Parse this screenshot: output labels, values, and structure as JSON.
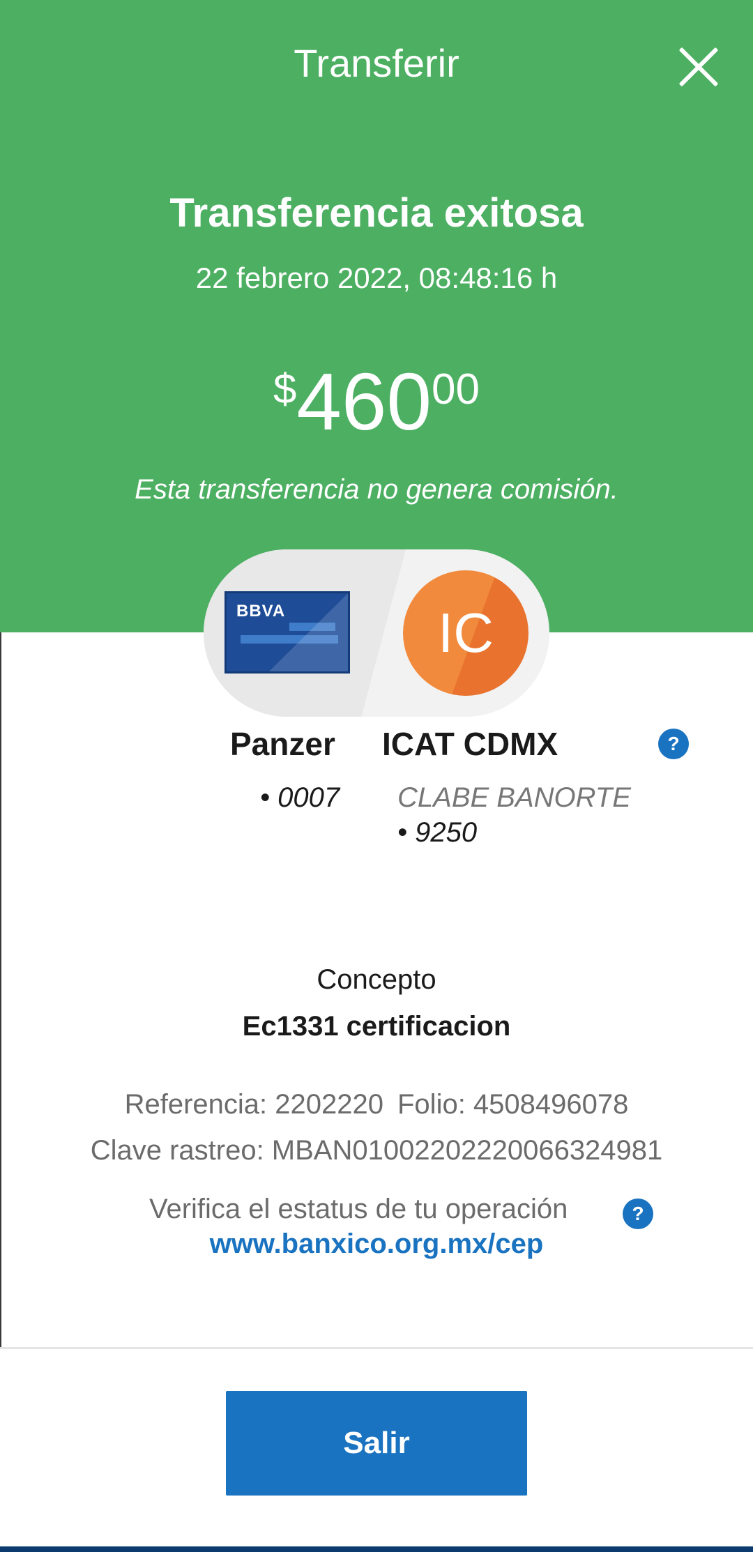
{
  "header": {
    "title": "Transferir",
    "bg_color": "#4caf62"
  },
  "summary": {
    "status_title": "Transferencia exitosa",
    "datetime": "22 febrero 2022, 08:48:16 h",
    "amount": {
      "currency_symbol": "$",
      "integer": "460",
      "cents": "00"
    },
    "fee_note": "Esta transferencia no genera comisión."
  },
  "from": {
    "card_brand": "BBVA",
    "name": "Panzer",
    "account": "• 0007"
  },
  "to": {
    "initials": "IC",
    "name": "ICAT CDMX",
    "bank": "CLABE BANORTE",
    "account": "• 9250"
  },
  "details": {
    "concept_label": "Concepto",
    "concept_value": "Ec1331 certificacion",
    "reference": "Referencia: 2202220",
    "folio": "Folio: 4508496078",
    "tracking_key": "Clave rastreo: MBAN01002202220066324981",
    "verify_text": "Verifica el estatus de tu operación",
    "verify_link": "www.banxico.org.mx/cep"
  },
  "actions": {
    "exit_label": "Salir"
  },
  "icons": {
    "close": "close-icon",
    "help": "help-icon"
  },
  "colors": {
    "accent_blue": "#1a73c0",
    "success_green": "#4caf62",
    "avatar_orange": "#f18a3c"
  }
}
